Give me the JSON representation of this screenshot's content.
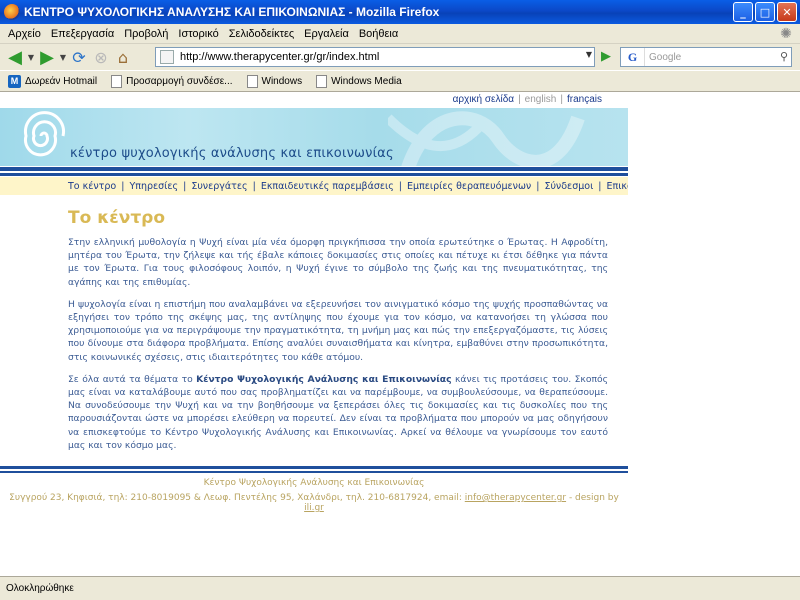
{
  "window": {
    "title": "ΚΕΝΤΡΟ ΨΥΧΟΛΟΓΙΚΗΣ ΑΝΑΛΥΣΗΣ ΚΑΙ ΕΠΙΚΟΙΝΩΝΙΑΣ - Mozilla Firefox",
    "minimize": "_",
    "maximize": "□",
    "close": "✕"
  },
  "menu": [
    "Αρχείο",
    "Επεξεργασία",
    "Προβολή",
    "Ιστορικό",
    "Σελιδοδείκτες",
    "Εργαλεία",
    "Βοήθεια"
  ],
  "navbar": {
    "url": "http://www.therapycenter.gr/gr/index.html",
    "search_placeholder": "Google",
    "search_engine": "G"
  },
  "bookmarks": [
    "Δωρεάν Hotmail",
    "Προσαρμογή συνδέσε...",
    "Windows",
    "Windows Media"
  ],
  "page": {
    "langs": [
      "αρχική σελίδα",
      "english",
      "français"
    ],
    "site_title": "κέντρο ψυχολογικής ανάλυσης και επικοινωνίας",
    "nav": [
      "Το κέντρο",
      "Υπηρεσίες",
      "Συνεργάτες",
      "Εκπαιδευτικές παρεμβάσεις",
      "Εμπειρίες θεραπευόμενων",
      "Σύνδεσμοι",
      "Επικοινωνία"
    ],
    "heading": "Το κέντρο",
    "p1": "Στην ελληνική μυθολογία η Ψυχή είναι μία νέα όμορφη πριγκήπισσα την οποία ερωτεύτηκε ο Έρωτας. Η Αφροδίτη, μητέρα του Έρωτα, την ζήλεψε και τής έβαλε κάποιες δοκιμασίες στις οποίες και πέτυχε κι έτσι δέθηκε για πάντα με τον Έρωτα. Για τους φιλοσόφους λοιπόν, η Ψυχή έγινε το σύμβολο της ζωής και της πνευματικότητας, της αγάπης και της επιθυμίας.",
    "p2": "Η ψυχολογία είναι η επιστήμη που αναλαμβάνει να εξερευνήσει τον αινιγματικό κόσμο της ψυχής προσπαθώντας να εξηγήσει τον τρόπο της σκέψης μας, της αντίληψης που έχουμε για τον κόσμο, να κατανοήσει τη γλώσσα που χρησιμοποιούμε για να περιγράψουμε την πραγματικότητα, τη μνήμη μας και πώς την επεξεργαζόμαστε, τις λύσεις που δίνουμε στα διάφορα προβλήματα. Επίσης αναλύει συναισθήματα και κίνητρα, εμβαθύνει στην προσωπικότητα, στις κοινωνικές σχέσεις, στις ιδιαιτερότητες του κάθε ατόμου.",
    "p3_before": "Σε όλα αυτά τα θέματα το ",
    "p3_bold": "Κέντρο Ψυχολογικής Ανάλυσης και Επικοινωνίας",
    "p3_after": " κάνει τις προτάσεις του. Σκοπός μας είναι να καταλάβουμε αυτό που σας προβληματίζει και να παρέμβουμε, να συμβουλεύσουμε, να θεραπεύσουμε. Να συνοδεύσουμε την Ψυχή και να την βοηθήσουμε να ξεπεράσει όλες τις δοκιμασίες και τις δυσκολίες που της παρουσιάζονται ώστε να μπορέσει ελεύθερη να πορευτεί. Δεν είναι τα προβλήματα που μπορούν να μας οδηγήσουν να επισκεφτούμε το Κέντρο Ψυχολογικής Ανάλυσης και Επικοινωνίας. Αρκεί να θέλουμε να γνωρίσουμε τον εαυτό μας και τον κόσμο μας.",
    "footer_name": "Κέντρο Ψυχολογικής Ανάλυσης και Επικοινωνίας",
    "footer_address": "Συγγρού 23, Κηφισιά, τηλ: 210-8019095 & Λεωφ. Πεντέλης 95, Χαλάνδρι, τηλ. 210-6817924, email: ",
    "footer_email": "info@therapycenter.gr",
    "footer_design": " - design by ",
    "footer_designer": "ili.gr"
  },
  "status": "Ολοκληρώθηκε",
  "colors": {
    "heading": "#d9b955",
    "body_text": "#3c5c94",
    "stripe": "#1f4f9c",
    "nav_bg": "#fef5c9",
    "banner": "#a6dcea"
  }
}
